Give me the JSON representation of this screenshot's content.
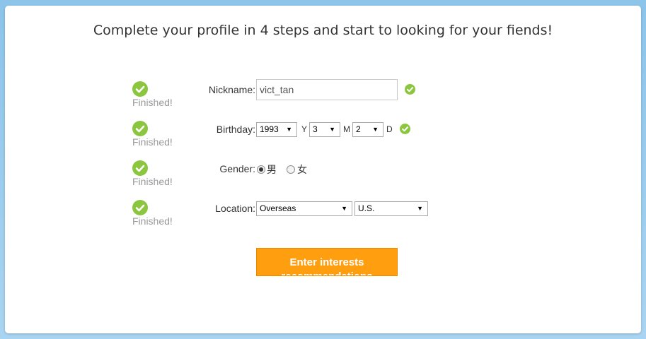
{
  "header": {
    "title": "Complete your profile in 4 steps and start to looking for your fiends!"
  },
  "steps": [
    {
      "status": "Finished!",
      "label": "Nickname:"
    },
    {
      "status": "Finished!",
      "label": "Birthday:"
    },
    {
      "status": "Finished!",
      "label": "Gender:"
    },
    {
      "status": "Finished!",
      "label": "Location:"
    }
  ],
  "nickname": {
    "value": "vict_tan"
  },
  "birthday": {
    "year": "1993",
    "year_unit": "Y",
    "month": "3",
    "month_unit": "M",
    "day": "2",
    "day_unit": "D"
  },
  "gender": {
    "options": [
      {
        "label": "男",
        "selected": true
      },
      {
        "label": "女",
        "selected": false
      }
    ]
  },
  "location": {
    "country": "Overseas",
    "region": "U.S."
  },
  "submit_button": {
    "label": "Enter interests recommendations"
  },
  "colors": {
    "accent": "#ff9e0f",
    "check_green": "#8cc63f"
  }
}
